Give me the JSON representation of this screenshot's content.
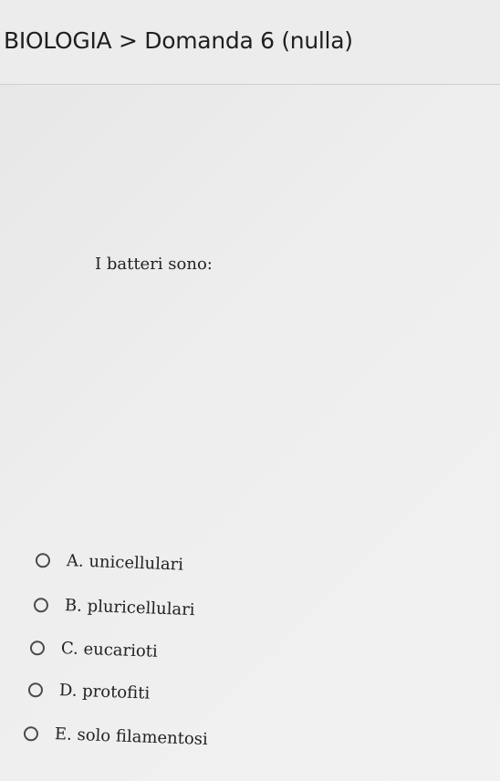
{
  "header": {
    "breadcrumb": "BIOLOGIA > Domanda 6 (nulla)"
  },
  "question": {
    "text": "I batteri sono:"
  },
  "options": [
    {
      "label": "A. unicellulari"
    },
    {
      "label": "B. pluricellulari"
    },
    {
      "label": "C. eucarioti"
    },
    {
      "label": "D. protofiti"
    },
    {
      "label": "E. solo filamentosi"
    }
  ]
}
